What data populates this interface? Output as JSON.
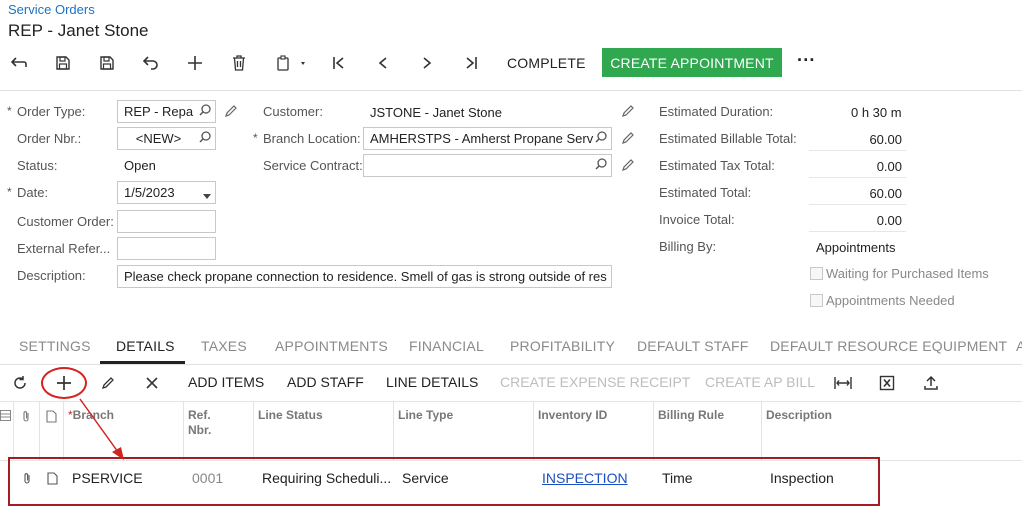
{
  "breadcrumb": "Service Orders",
  "title": "REP - Janet Stone",
  "toolbar": {
    "icons": [
      "back-icon",
      "save-icon",
      "save-close-icon",
      "undo-icon",
      "add-icon",
      "delete-icon",
      "copy-paste-icon",
      "first-icon",
      "prev-icon",
      "next-icon",
      "last-icon",
      "more-icon"
    ],
    "complete_label": "COMPLETE",
    "create_appointment_label": "CREATE APPOINTMENT",
    "more_label": "···",
    "create_appointment_color": "#2fa84f"
  },
  "form": {
    "order_type": {
      "label": "Order Type:",
      "value": "REP - Repa"
    },
    "order_nbr": {
      "label": "Order Nbr.:",
      "value": "<NEW>"
    },
    "status": {
      "label": "Status:",
      "value": "Open"
    },
    "date": {
      "label": "Date:",
      "value": "1/5/2023"
    },
    "customer_order": {
      "label": "Customer Order:",
      "value": ""
    },
    "external_ref": {
      "label": "External Refer...",
      "value": ""
    },
    "description": {
      "label": "Description:",
      "value": "Please check propane connection to residence.  Smell of gas is strong outside of res"
    },
    "customer": {
      "label": "Customer:",
      "value": "JSTONE - Janet Stone"
    },
    "branch_location": {
      "label": "Branch Location:",
      "value": "AMHERSTPS - Amherst Propane Serv"
    },
    "service_contract": {
      "label": "Service Contract:",
      "value": ""
    },
    "estimated_duration": {
      "label": "Estimated Duration:",
      "value": "0 h 30 m"
    },
    "estimated_billable_total": {
      "label": "Estimated Billable Total:",
      "value": "60.00"
    },
    "estimated_tax_total": {
      "label": "Estimated Tax Total:",
      "value": "0.00"
    },
    "estimated_total": {
      "label": "Estimated Total:",
      "value": "60.00"
    },
    "invoice_total": {
      "label": "Invoice Total:",
      "value": "0.00"
    },
    "billing_by": {
      "label": "Billing By:",
      "value": "Appointments"
    },
    "waiting_for_purchased": {
      "label": "Waiting for Purchased Items",
      "checked": false
    },
    "appointments_needed": {
      "label": "Appointments Needed",
      "checked": false
    }
  },
  "tabs": [
    "SETTINGS",
    "DETAILS",
    "TAXES",
    "APPOINTMENTS",
    "FINANCIAL",
    "PROFITABILITY",
    "DEFAULT STAFF",
    "DEFAULT RESOURCE EQUIPMENT",
    "A"
  ],
  "active_tab": "DETAILS",
  "grid_toolbar": {
    "add_items": "ADD ITEMS",
    "add_staff": "ADD STAFF",
    "line_details": "LINE DETAILS",
    "create_expense_receipt": "CREATE EXPENSE RECEIPT",
    "create_ap_bill": "CREATE AP BILL"
  },
  "grid": {
    "headers": {
      "branch": "Branch",
      "ref_nbr_1": "Ref.",
      "ref_nbr_2": "Nbr.",
      "line_status": "Line Status",
      "line_type": "Line Type",
      "inventory_id": "Inventory ID",
      "billing_rule": "Billing Rule",
      "description": "Description"
    },
    "rows": [
      {
        "branch": "PSERVICE",
        "ref_nbr": "0001",
        "line_status": "Requiring Scheduli...",
        "line_type": "Service",
        "inventory_id": "INSPECTION",
        "billing_rule": "Time",
        "description": "Inspection"
      }
    ]
  },
  "annotation_color": "#d32222"
}
